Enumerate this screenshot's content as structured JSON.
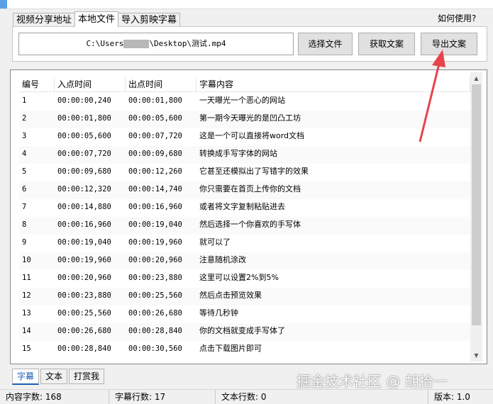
{
  "tabs": [
    "视频分享地址",
    "本地文件",
    "导入剪映字幕"
  ],
  "help_link": "如何使用?",
  "path": {
    "prefix": "C:\\Users",
    "suffix": "\\Desktop\\测试.mp4"
  },
  "buttons": {
    "select": "选择文件",
    "get": "获取文案",
    "export": "导出文案"
  },
  "columns": [
    "编号",
    "入点时间",
    "出点时间",
    "字幕内容"
  ],
  "rows": [
    [
      "1",
      "00:00:00,240",
      "00:00:01,800",
      "一天曝光一个恶心的网站"
    ],
    [
      "2",
      "00:00:01,800",
      "00:00:05,600",
      "第一期今天曝光的是凹凸工坊"
    ],
    [
      "3",
      "00:00:05,600",
      "00:00:07,720",
      "这是一个可以直接将word文档"
    ],
    [
      "4",
      "00:00:07,720",
      "00:00:09,680",
      "转换成手写字体的网站"
    ],
    [
      "5",
      "00:00:09,680",
      "00:00:12,260",
      "它甚至还模拟出了写错字的效果"
    ],
    [
      "6",
      "00:00:12,320",
      "00:00:14,740",
      "你只需要在首页上传你的文档"
    ],
    [
      "7",
      "00:00:14,880",
      "00:00:16,960",
      "或者将文字复制粘贴进去"
    ],
    [
      "8",
      "00:00:16,960",
      "00:00:19,040",
      "然后选择一个你喜欢的手写体"
    ],
    [
      "9",
      "00:00:19,040",
      "00:00:19,960",
      "就可以了"
    ],
    [
      "10",
      "00:00:19,960",
      "00:00:20,960",
      "注意随机涂改"
    ],
    [
      "11",
      "00:00:20,960",
      "00:00:23,880",
      "这里可以设置2%到5%"
    ],
    [
      "12",
      "00:00:23,880",
      "00:00:25,560",
      "然后点击预览效果"
    ],
    [
      "13",
      "00:00:25,560",
      "00:00:26,680",
      "等待几秒钟"
    ],
    [
      "14",
      "00:00:26,680",
      "00:00:28,840",
      "你的文档就变成手写体了"
    ],
    [
      "15",
      "00:00:28,840",
      "00:00:30,560",
      "点击下载图片即可"
    ]
  ],
  "bottom_tabs": [
    "字幕",
    "文本",
    "打赏我"
  ],
  "watermark": "掘金技术社区 @ 胡拾一",
  "status": {
    "chars": "内容字数: 168",
    "subtitle_lines": "字幕行数: 17",
    "text_lines": "文本行数: 0",
    "version": "版本: 1.0"
  },
  "colors": {
    "accent": "#1a5fb4",
    "arrow": "#e8434b"
  }
}
